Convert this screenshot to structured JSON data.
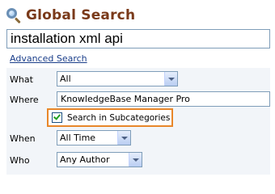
{
  "header": {
    "title": "Global Search",
    "icon": "search-icon"
  },
  "query": {
    "value": "installation xml api"
  },
  "advanced_link": "Advanced Search",
  "form": {
    "what": {
      "label": "What",
      "value": "All"
    },
    "where": {
      "label": "Where",
      "value": "KnowledgeBase Manager Pro"
    },
    "subcategories": {
      "label": "Search in Subcategories",
      "checked": true
    },
    "when": {
      "label": "When",
      "value": "All Time"
    },
    "who": {
      "label": "Who",
      "value": "Any Author"
    }
  },
  "colors": {
    "title": "#7a3a1a",
    "link": "#1a3e8a",
    "highlight": "#e8872a",
    "form_bg": "#f2f5f9"
  }
}
